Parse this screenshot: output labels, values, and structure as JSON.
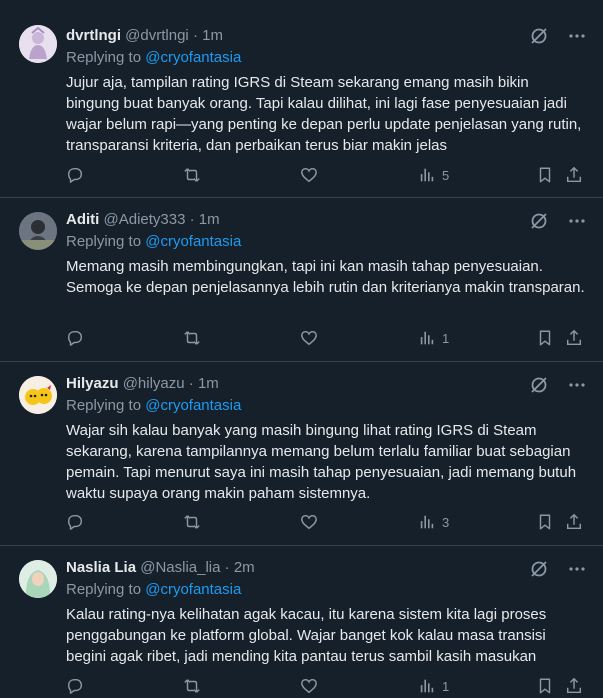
{
  "replies": [
    {
      "name": "dvrtlngi",
      "handle": "@dvrtlngi",
      "time": "1m",
      "replying_label": "Replying to",
      "replying_to": "@cryofantasia",
      "text": "Jujur aja, tampilan rating IGRS di Steam sekarang emang masih bikin bingung buat banyak orang. Tapi kalau dilihat, ini lagi fase penyesuaian jadi wajar belum rapi—yang penting ke depan perlu update penjelasan yang rutin, transparansi kriteria, dan perbaikan terus biar makin jelas",
      "views": "5",
      "avatar_color": "#d9cfe3"
    },
    {
      "name": "Aditi",
      "handle": "@Adiety333",
      "time": "1m",
      "replying_label": "Replying to",
      "replying_to": "@cryofantasia",
      "text": "Memang masih membingungkan, tapi ini kan masih tahap penyesuaian. Semoga ke depan penjelasannya lebih rutin dan kriterianya makin transparan.",
      "views": "1",
      "avatar_color": "#5d6a7a"
    },
    {
      "name": "Hilyazu",
      "handle": "@hilyazu",
      "time": "1m",
      "replying_label": "Replying to",
      "replying_to": "@cryofantasia",
      "text": "Wajar sih kalau banyak yang masih bingung lihat rating IGRS di Steam sekarang, karena tampilannya memang belum terlalu familiar buat sebagian pemain. Tapi menurut saya ini masih tahap penyesuaian, jadi memang butuh waktu supaya orang makin paham sistemnya.",
      "views": "3",
      "avatar_color": "#f2e6d8"
    },
    {
      "name": "Naslia Lia",
      "handle": "@Naslia_lia",
      "time": "2m",
      "replying_label": "Replying to",
      "replying_to": "@cryofantasia",
      "text": "Kalau rating-nya kelihatan agak kacau, itu karena sistem kita lagi proses penggabungan ke platform global. Wajar banget kok kalau masa transisi begini agak ribet, jadi mending kita pantau terus sambil kasih masukan",
      "views": "1",
      "avatar_color": "#cfe3d4"
    }
  ]
}
